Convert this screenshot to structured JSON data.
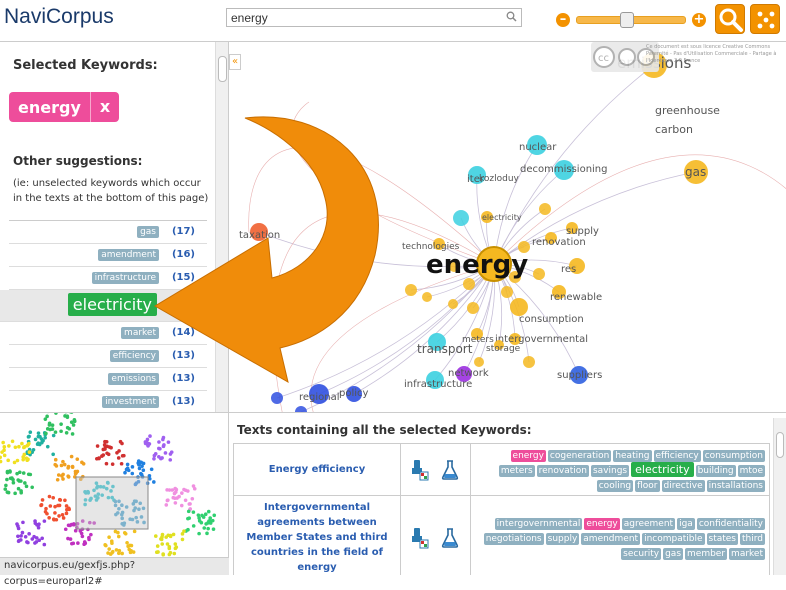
{
  "app": {
    "logo_text": "NaviCorpus"
  },
  "search": {
    "value": "energy"
  },
  "zoom": {
    "level": 0.45
  },
  "left_panel": {
    "selected_title": "Selected Keywords:",
    "selected_keyword": "energy",
    "remove_label": "x",
    "other_title": "Other suggestions:",
    "other_hint": "(ie: unselected keywords which occur in the texts at the bottom of this page)",
    "suggestions": [
      {
        "kw": "gas",
        "count": "(17)"
      },
      {
        "kw": "amendment",
        "count": "(16)"
      },
      {
        "kw": "infrastructure",
        "count": "(15)"
      },
      {
        "kw": "electricity",
        "count": ""
      },
      {
        "kw": "market",
        "count": "(14)"
      },
      {
        "kw": "efficiency",
        "count": "(13)"
      },
      {
        "kw": "emissions",
        "count": "(13)"
      },
      {
        "kw": "investment",
        "count": "(13)"
      }
    ]
  },
  "graph": {
    "collapse_label": "«",
    "center_label": "energy",
    "labels": [
      "emissions",
      "greenhouse",
      "carbon",
      "gas",
      "nuclear",
      "decommissioning",
      "iter",
      "kozloduy",
      "electricity",
      "taxation",
      "technologies",
      "supply",
      "renovation",
      "res",
      "renewable",
      "consumption",
      "meters",
      "intergovernmental",
      "storage",
      "transport",
      "network",
      "infrastructure",
      "suppliers",
      "regional",
      "policy"
    ],
    "license_text": "Ce document est sous licence Creative Commons Paternité - Pas d'Utilisation Commerciale - Partage à l'Identique 2.0 France"
  },
  "texts": {
    "title": "Texts containing all the selected Keywords:",
    "docs": [
      {
        "title": "Energy efficiency",
        "tags": [
          [
            "energy",
            "pink"
          ],
          [
            "cogeneration",
            ""
          ],
          [
            "heating",
            ""
          ],
          [
            "efficiency",
            ""
          ],
          [
            "consumption",
            ""
          ],
          [
            "meters",
            ""
          ],
          [
            "renovation",
            ""
          ],
          [
            "savings",
            ""
          ],
          [
            "electricity",
            "green"
          ],
          [
            "building",
            ""
          ],
          [
            "mtoe",
            ""
          ],
          [
            "cooling",
            ""
          ],
          [
            "floor",
            ""
          ],
          [
            "directive",
            ""
          ],
          [
            "installations",
            ""
          ]
        ]
      },
      {
        "title": "Intergovernmental agreements between Member States and third countries in the field of energy",
        "tags": [
          [
            "intergovernmental",
            ""
          ],
          [
            "energy",
            "pink"
          ],
          [
            "agreement",
            ""
          ],
          [
            "iga",
            ""
          ],
          [
            "confidentiality",
            ""
          ],
          [
            "negotiations",
            ""
          ],
          [
            "supply",
            ""
          ],
          [
            "amendment",
            ""
          ],
          [
            "incompatible",
            ""
          ],
          [
            "states",
            ""
          ],
          [
            "third",
            ""
          ],
          [
            "security",
            ""
          ],
          [
            "gas",
            ""
          ],
          [
            "member",
            ""
          ],
          [
            "market",
            ""
          ]
        ]
      }
    ]
  },
  "status": {
    "url": "navicorpus.eu/gexfjs.php?corpus=europarl2#"
  },
  "colors": {
    "accent": "#f39200",
    "selected": "#ee4d9b",
    "highlight": "#27ae4a",
    "tag": "#8fb0c0"
  }
}
